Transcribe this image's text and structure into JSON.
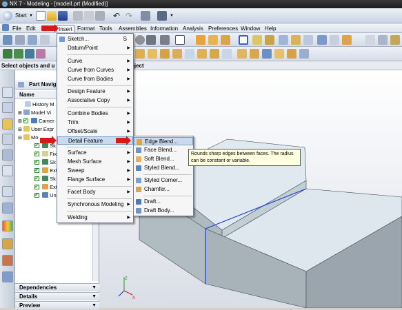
{
  "window": {
    "title": "NX 7 - Modeling - [modelI.prt (Modified)]"
  },
  "quick_access": {
    "start_label": "Start"
  },
  "menubar": {
    "items": [
      "File",
      "Edit",
      "View",
      "Insert",
      "Format",
      "Tools",
      "Assemblies",
      "Information",
      "Analysis",
      "Preferences",
      "Window",
      "Help"
    ],
    "active": "Insert"
  },
  "cue_line": {
    "text": "Select objects and u",
    "text_right": "bject"
  },
  "insert_menu": {
    "items": [
      {
        "label": "Sketch...",
        "shortcut": "S",
        "submenu": false
      },
      {
        "label": "Datum/Point",
        "submenu": true
      },
      {
        "label": "Curve",
        "submenu": true
      },
      {
        "label": "Curve from Curves",
        "submenu": true
      },
      {
        "label": "Curve from Bodies",
        "submenu": true
      },
      {
        "label": "Design Feature",
        "submenu": true
      },
      {
        "label": "Associative Copy",
        "submenu": true
      },
      {
        "label": "Combine Bodies",
        "submenu": true
      },
      {
        "label": "Trim",
        "submenu": true
      },
      {
        "label": "Offset/Scale",
        "submenu": true
      },
      {
        "label": "Detail Feature",
        "submenu": true
      },
      {
        "label": "Surface",
        "submenu": true
      },
      {
        "label": "Mesh Surface",
        "submenu": true
      },
      {
        "label": "Sweep",
        "submenu": true
      },
      {
        "label": "Flange Surface",
        "submenu": true
      },
      {
        "label": "Facet Body",
        "submenu": true
      },
      {
        "label": "Synchronous Modeling",
        "submenu": true
      },
      {
        "label": "Welding",
        "submenu": true
      }
    ]
  },
  "detail_feature_menu": {
    "items": [
      "Edge Blend...",
      "Face Blend...",
      "Soft Blend...",
      "Styled Blend...",
      "Styled Corner...",
      "Chamfer...",
      "Draft...",
      "Draft Body..."
    ],
    "highlighted": "Edge Blend..."
  },
  "tooltip": {
    "text": "Rounds sharp edges between faces. The radius can be constant or variable."
  },
  "navigator": {
    "title": "Part Navig",
    "column": "Name",
    "tree": [
      {
        "label": "History M",
        "indent": 1,
        "checked": false
      },
      {
        "label": "Model Vi",
        "indent": 0,
        "checked": false
      },
      {
        "label": "Camer",
        "indent": 0,
        "checked": true
      },
      {
        "label": "User Expr",
        "indent": 0,
        "checked": false
      },
      {
        "label": "Mo",
        "indent": 0,
        "checked": false
      },
      {
        "label": "Sk",
        "indent": 2,
        "checked": true
      },
      {
        "label": "Fix",
        "indent": 2,
        "checked": true
      },
      {
        "label": "Sk",
        "indent": 2,
        "checked": true
      },
      {
        "label": "Ext",
        "indent": 2,
        "checked": true
      },
      {
        "label": "Sk",
        "indent": 2,
        "checked": true
      },
      {
        "label": "Ext",
        "indent": 2,
        "checked": true
      },
      {
        "label": "Uni",
        "indent": 2,
        "checked": true
      }
    ],
    "sections": [
      "Dependencies",
      "Details",
      "Preview"
    ]
  },
  "colors": {
    "menu_highlight": "#c9d9ef",
    "tooltip_bg": "#ffffe1",
    "model_face_top": "#dfe9ef",
    "model_face_front": "#b2bdc4",
    "model_face_side": "#9aa5ad",
    "selection_edge": "#1a3fd6",
    "red_arrow": "#d51a1a"
  }
}
